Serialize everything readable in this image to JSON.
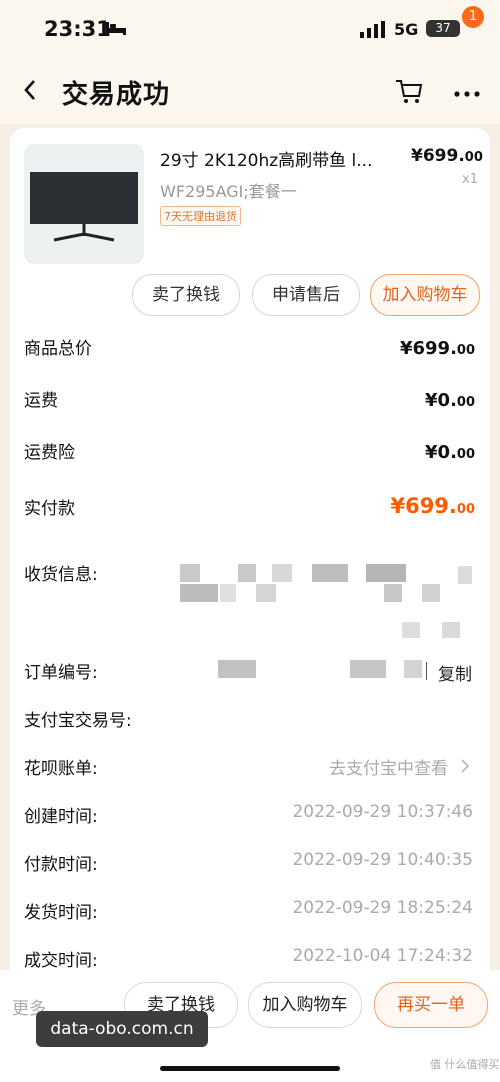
{
  "status_bar": {
    "time": "23:31",
    "network": "5G",
    "battery": "37"
  },
  "nav": {
    "title": "交易成功",
    "cart_badge": "1"
  },
  "product": {
    "name": "29寸 2K120hz高刷带鱼 l...",
    "spec": "WF295AGI;套餐一",
    "tag": "7天无理由退货",
    "price_main": "¥699.",
    "price_dec": "00",
    "qty": "x1"
  },
  "actions": {
    "sell": "卖了换钱",
    "after_sale": "申请售后",
    "add_cart": "加入购物车"
  },
  "summary": {
    "total_label": "商品总价",
    "total_main": "¥699.",
    "total_dec": "00",
    "ship_label": "运费",
    "ship_main": "¥0.",
    "ship_dec": "00",
    "insurance_label": "运费险",
    "insurance_main": "¥0.",
    "insurance_dec": "00",
    "paid_label": "实付款",
    "paid_main": "¥699.",
    "paid_dec": "00"
  },
  "info": {
    "address_label": "收货信息:",
    "order_no_label": "订单编号:",
    "copy": "复制",
    "alipay_no_label": "支付宝交易号:",
    "huabei_label": "花呗账单:",
    "huabei_value": "去支付宝中查看",
    "created_label": "创建时间:",
    "created_value": "2022-09-29 10:37:46",
    "paid_time_label": "付款时间:",
    "paid_time_value": "2022-09-29 10:40:35",
    "shipped_label": "发货时间:",
    "shipped_value": "2022-09-29 18:25:24",
    "done_label": "成交时间:",
    "done_value": "2022-10-04 17:24:32"
  },
  "bottom": {
    "more": "更多",
    "sell": "卖了换钱",
    "add_cart": "加入购物车",
    "rebuy": "再买一单"
  },
  "watermark": "data-obo.com.cn",
  "corner_mark": "值 什么值得买",
  "colors": {
    "accent": "#ff5a00",
    "background": "#f6efe6"
  }
}
